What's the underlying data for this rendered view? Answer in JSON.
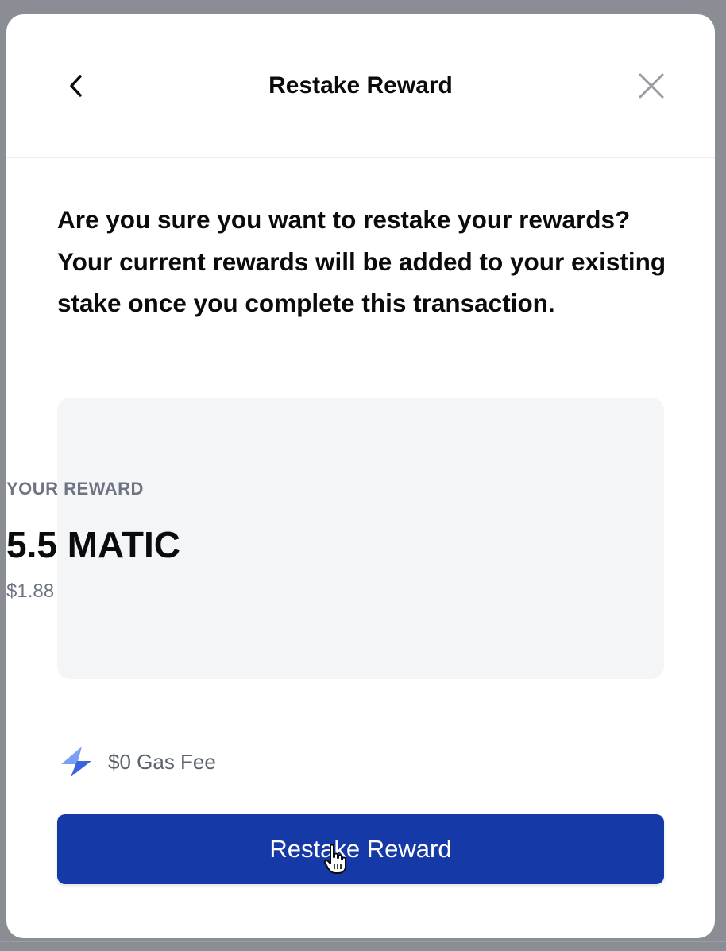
{
  "header": {
    "title": "Restake Reward",
    "back_icon": "chevron-left-icon",
    "close_icon": "close-icon"
  },
  "body": {
    "question": "Are you sure you want to restake your rewards? Your current rewards will be added to your existing stake once you complete this transaction."
  },
  "reward": {
    "label": "YOUR REWARD",
    "amount": "5.5 MATIC",
    "usd": "$1.88"
  },
  "footer": {
    "gas_icon": "lightning-bolt-icon",
    "gas_fee": "$0 Gas Fee",
    "primary_button": "Restake Reward"
  },
  "colors": {
    "primary": "#1639a8",
    "gas_icon_light": "#7aa0f5",
    "gas_icon_dark": "#3a63dd",
    "text_primary": "#0a0b0d",
    "text_muted": "#6f7482",
    "card_bg": "#f4f5f7"
  }
}
